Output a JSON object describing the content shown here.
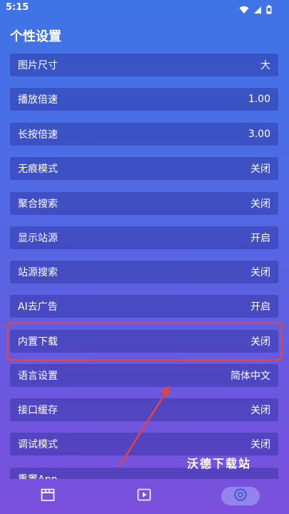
{
  "status_bar": {
    "time": "5:15",
    "icons": [
      "wifi-icon",
      "signal-icon",
      "battery-icon"
    ]
  },
  "page": {
    "title": "个性设置"
  },
  "settings": [
    {
      "label": "图片尺寸",
      "value": "大"
    },
    {
      "label": "播放倍速",
      "value": "1.00"
    },
    {
      "label": "长按倍速",
      "value": "3.00"
    },
    {
      "label": "无痕模式",
      "value": "关闭"
    },
    {
      "label": "聚合搜索",
      "value": "关闭"
    },
    {
      "label": "显示站源",
      "value": "开启"
    },
    {
      "label": "站源搜索",
      "value": "关闭"
    },
    {
      "label": "AI去广告",
      "value": "开启"
    },
    {
      "label": "内置下载",
      "value": "关闭"
    },
    {
      "label": "语言设置",
      "value": "简体中文"
    },
    {
      "label": "接口缓存",
      "value": "关闭"
    },
    {
      "label": "调试模式",
      "value": "关闭"
    },
    {
      "label": "重置App",
      "value": ""
    }
  ],
  "overlay": {
    "watermark": "沃德下载站",
    "highlight_color": "#e2453f"
  },
  "bottom_nav": {
    "items": [
      {
        "icon": "clapperboard-icon",
        "active": false
      },
      {
        "icon": "play-icon",
        "active": false
      },
      {
        "icon": "gear-icon",
        "active": true
      }
    ]
  }
}
